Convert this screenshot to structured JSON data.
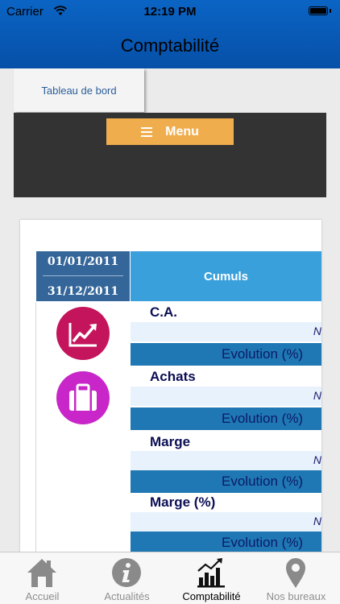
{
  "status_bar": {
    "carrier": "Carrier",
    "time": "12:19 PM"
  },
  "nav": {
    "title": "Comptabilité"
  },
  "breadcrumb": {
    "label": "Tableau de bord"
  },
  "menu": {
    "label": "Menu"
  },
  "table": {
    "date_start": "01/01/2011",
    "date_end": "31/12/2011",
    "header": "Cumuls",
    "rows": [
      {
        "label": "C.A.",
        "value": "N",
        "evolution": "Evolution (%)",
        "icon": "trending-up-icon",
        "icon_color": "#c4145c"
      },
      {
        "label": "Achats",
        "value": "N",
        "evolution": "Evolution (%)",
        "icon": "briefcase-icon",
        "icon_color": "#c826c8"
      },
      {
        "label": "Marge",
        "value": "N",
        "evolution": "Evolution (%)"
      },
      {
        "label": "Marge (%)",
        "value": "N",
        "evolution": "Evolution (%)"
      }
    ]
  },
  "tabbar": {
    "items": [
      {
        "label": "Accueil",
        "icon": "home-icon",
        "active": false
      },
      {
        "label": "Actualités",
        "icon": "info-icon",
        "active": false
      },
      {
        "label": "Comptabilité",
        "icon": "bar-chart-icon",
        "active": true
      },
      {
        "label": "Nos bureaux",
        "icon": "location-pin-icon",
        "active": false
      }
    ]
  },
  "colors": {
    "nav_blue": "#0b64c4",
    "menu_orange": "#f0ad4e",
    "header_blue": "#3aa0dc",
    "date_blue": "#34669a"
  }
}
